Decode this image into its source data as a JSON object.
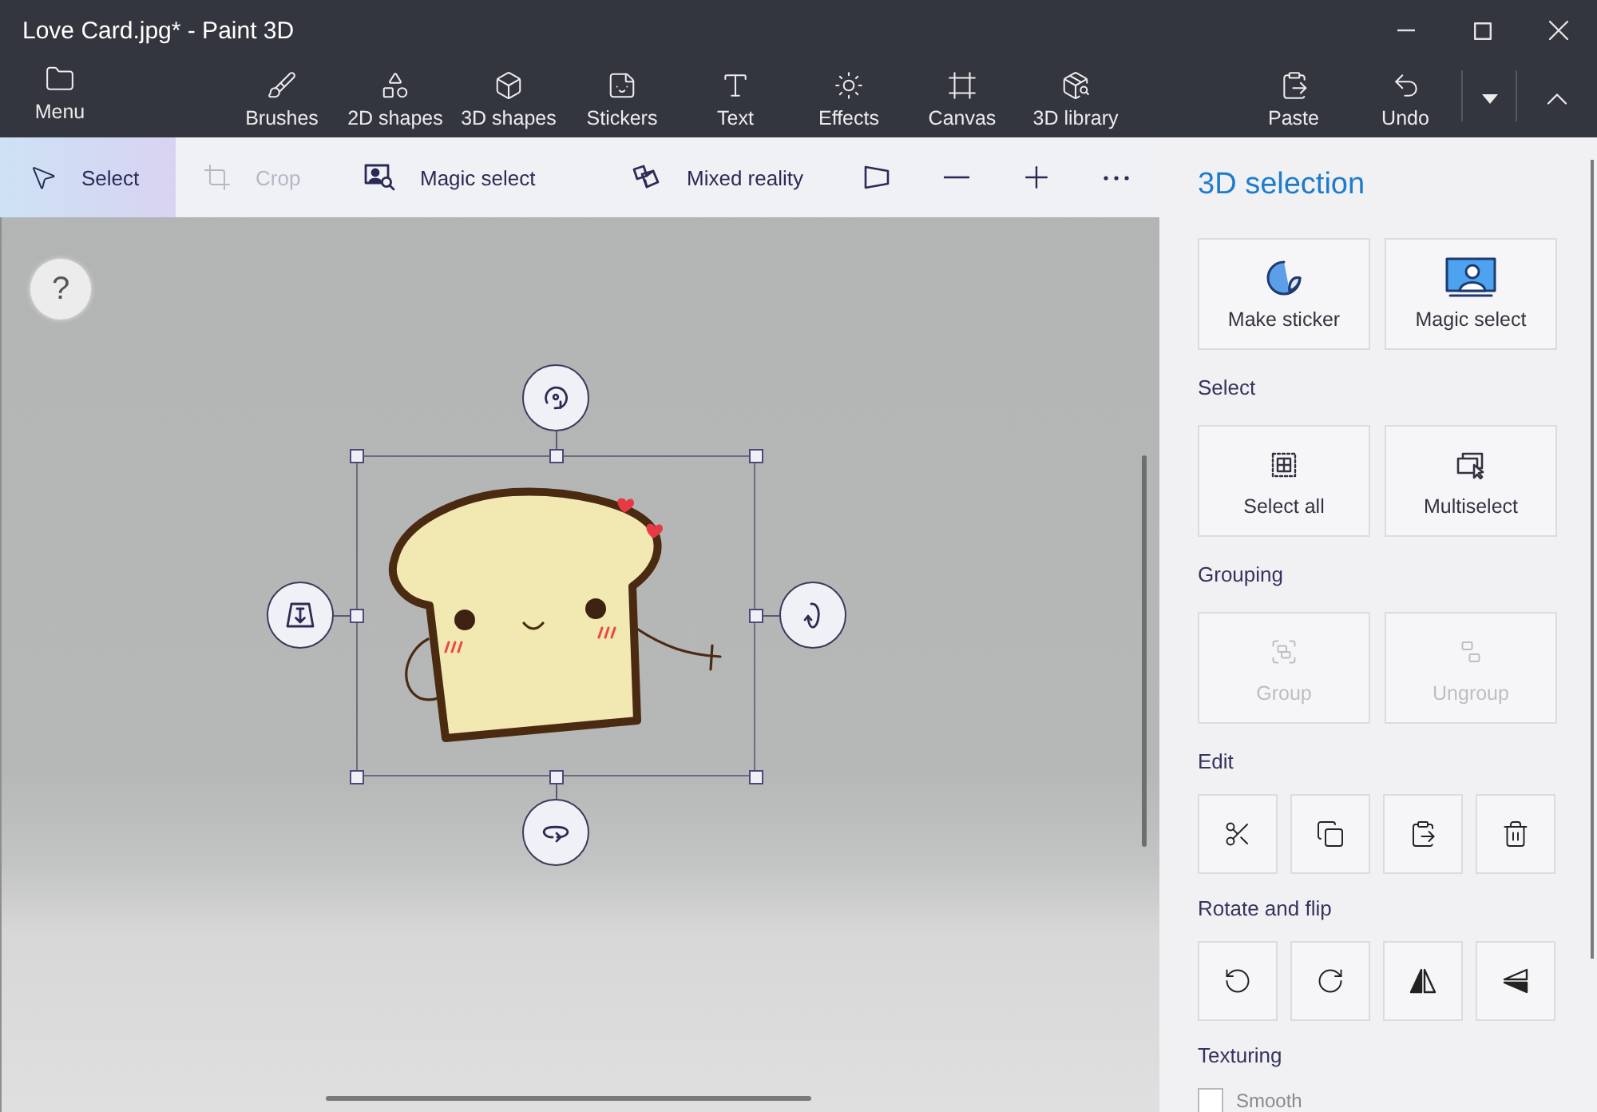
{
  "window": {
    "title": "Love Card.jpg* - Paint 3D"
  },
  "header": {
    "menu": {
      "label": "Menu"
    },
    "tools": [
      {
        "label": "Brushes",
        "selected": false
      },
      {
        "label": "2D shapes",
        "selected": false
      },
      {
        "label": "3D shapes",
        "selected": false
      },
      {
        "label": "Stickers",
        "selected": false
      },
      {
        "label": "Text",
        "selected": false
      },
      {
        "label": "Effects",
        "selected": false
      },
      {
        "label": "Canvas",
        "selected": false
      },
      {
        "label": "3D library",
        "selected": false
      }
    ],
    "actions": [
      {
        "label": "Paste"
      },
      {
        "label": "Undo"
      }
    ]
  },
  "command_bar": {
    "items": [
      {
        "label": "Select",
        "selected": true,
        "disabled": false
      },
      {
        "label": "Crop",
        "selected": false,
        "disabled": true
      },
      {
        "label": "Magic select",
        "selected": false,
        "disabled": false
      },
      {
        "label": "Mixed reality",
        "selected": false,
        "disabled": false
      }
    ]
  },
  "canvas": {
    "help": "?"
  },
  "panel": {
    "title": "3D selection",
    "actions": [
      {
        "label": "Make sticker"
      },
      {
        "label": "Magic select"
      }
    ],
    "sections": [
      {
        "heading": "Select",
        "kind": "cards",
        "buttons": [
          {
            "label": "Select all",
            "disabled": false
          },
          {
            "label": "Multiselect",
            "disabled": false
          }
        ]
      },
      {
        "heading": "Grouping",
        "kind": "cards",
        "buttons": [
          {
            "label": "Group",
            "disabled": true
          },
          {
            "label": "Ungroup",
            "disabled": true
          }
        ]
      },
      {
        "heading": "Edit",
        "kind": "icons",
        "buttons": [
          {
            "disabled": false
          },
          {
            "disabled": false
          },
          {
            "disabled": false
          },
          {
            "disabled": false
          }
        ]
      },
      {
        "heading": "Rotate and flip",
        "kind": "icons",
        "buttons": [
          {
            "disabled": false
          },
          {
            "disabled": false
          },
          {
            "disabled": false
          },
          {
            "disabled": false
          }
        ]
      },
      {
        "heading": "Texturing",
        "kind": "checkbox",
        "option": {
          "label": "Smooth",
          "checked": false
        }
      }
    ]
  }
}
